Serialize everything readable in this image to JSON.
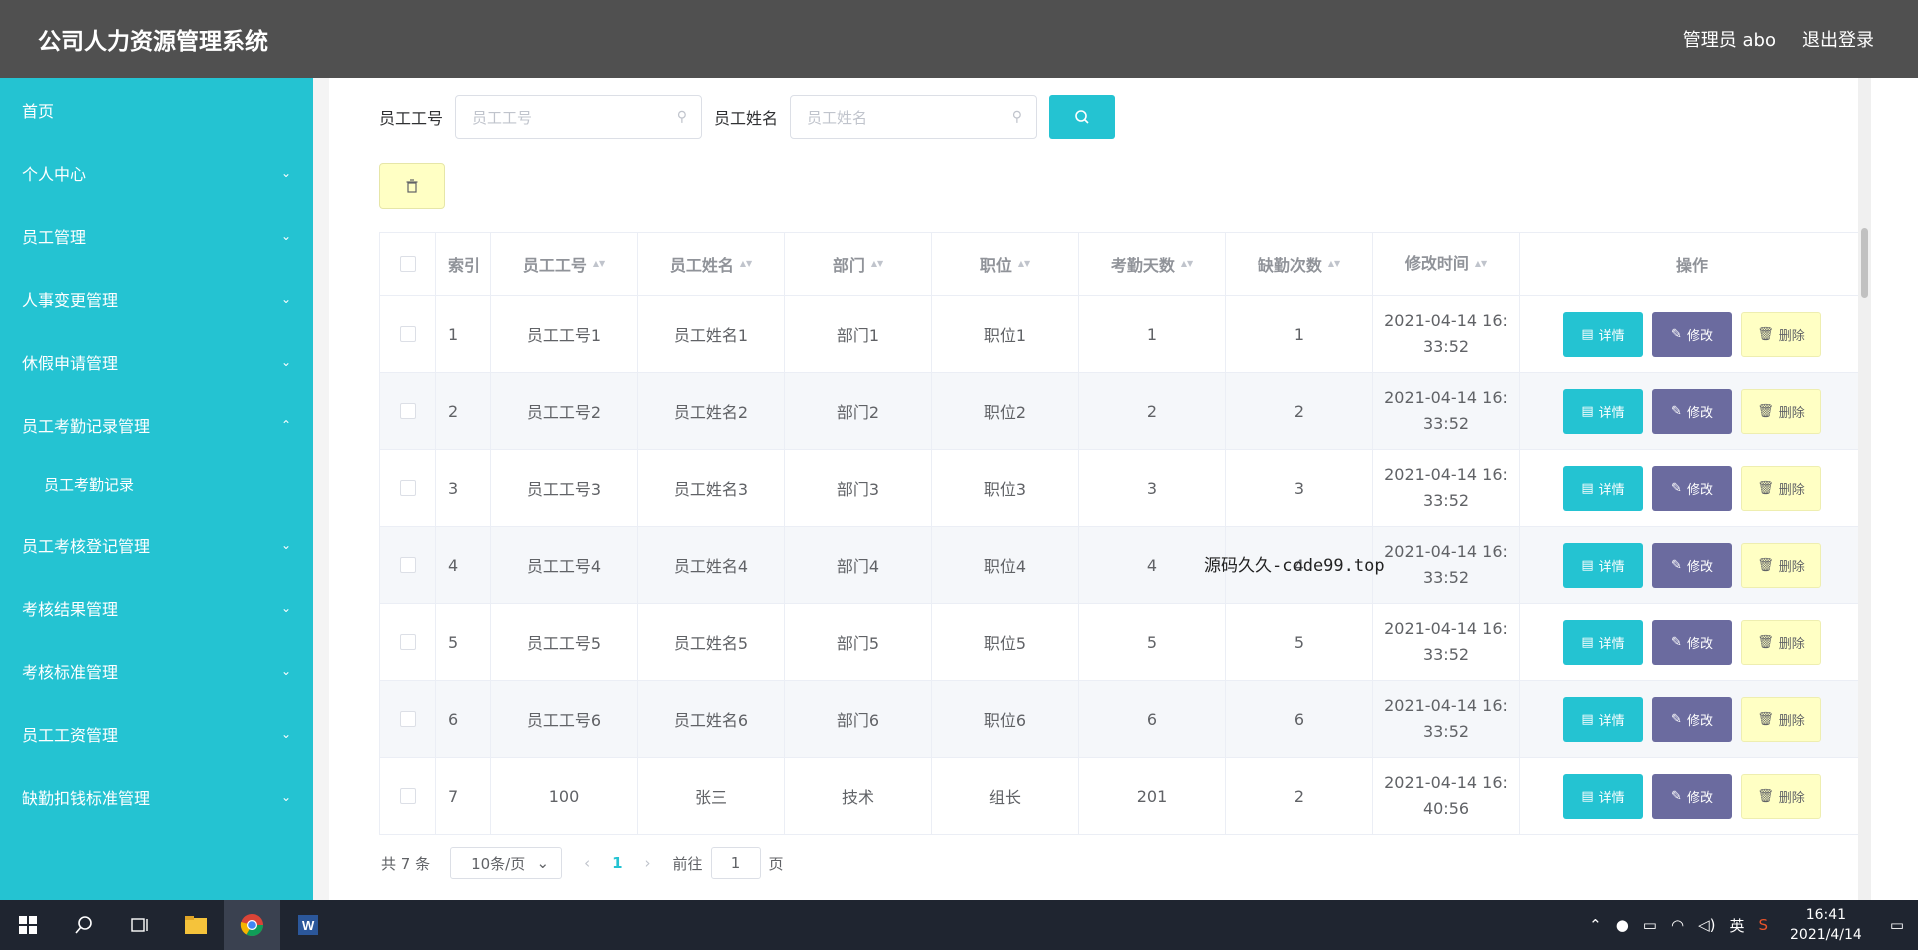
{
  "header": {
    "title": "公司人力资源管理系统",
    "admin": "管理员 abo",
    "logout": "退出登录"
  },
  "sidebar": {
    "items": [
      {
        "label": "首页",
        "chev": ""
      },
      {
        "label": "个人中心",
        "chev": "⌄"
      },
      {
        "label": "员工管理",
        "chev": "⌄"
      },
      {
        "label": "人事变更管理",
        "chev": "⌄"
      },
      {
        "label": "休假申请管理",
        "chev": "⌄"
      },
      {
        "label": "员工考勤记录管理",
        "chev": "⌃"
      },
      {
        "label": "员工考勤记录",
        "chev": ""
      },
      {
        "label": "员工考核登记管理",
        "chev": "⌄"
      },
      {
        "label": "考核结果管理",
        "chev": "⌄"
      },
      {
        "label": "考核标准管理",
        "chev": "⌄"
      },
      {
        "label": "员工工资管理",
        "chev": "⌄"
      },
      {
        "label": "缺勤扣钱标准管理",
        "chev": "⌄"
      }
    ]
  },
  "search": {
    "id_label": "员工工号",
    "id_placeholder": "员工工号",
    "name_label": "员工姓名",
    "name_placeholder": "员工姓名"
  },
  "table": {
    "headers": [
      "索引",
      "员工工号",
      "员工姓名",
      "部门",
      "职位",
      "考勤天数",
      "缺勤次数",
      "修改时间",
      "操作"
    ],
    "rows": [
      {
        "idx": "1",
        "id": "员工工号1",
        "name": "员工姓名1",
        "dept": "部门1",
        "pos": "职位1",
        "days": "1",
        "absent": "1",
        "time1": "2021-04-14 16:",
        "time2": "33:52"
      },
      {
        "idx": "2",
        "id": "员工工号2",
        "name": "员工姓名2",
        "dept": "部门2",
        "pos": "职位2",
        "days": "2",
        "absent": "2",
        "time1": "2021-04-14 16:",
        "time2": "33:52"
      },
      {
        "idx": "3",
        "id": "员工工号3",
        "name": "员工姓名3",
        "dept": "部门3",
        "pos": "职位3",
        "days": "3",
        "absent": "3",
        "time1": "2021-04-14 16:",
        "time2": "33:52"
      },
      {
        "idx": "4",
        "id": "员工工号4",
        "name": "员工姓名4",
        "dept": "部门4",
        "pos": "职位4",
        "days": "4",
        "absent": "4",
        "time1": "2021-04-14 16:",
        "time2": "33:52"
      },
      {
        "idx": "5",
        "id": "员工工号5",
        "name": "员工姓名5",
        "dept": "部门5",
        "pos": "职位5",
        "days": "5",
        "absent": "5",
        "time1": "2021-04-14 16:",
        "time2": "33:52"
      },
      {
        "idx": "6",
        "id": "员工工号6",
        "name": "员工姓名6",
        "dept": "部门6",
        "pos": "职位6",
        "days": "6",
        "absent": "6",
        "time1": "2021-04-14 16:",
        "time2": "33:52"
      },
      {
        "idx": "7",
        "id": "100",
        "name": "张三",
        "dept": "技术",
        "pos": "组长",
        "days": "201",
        "absent": "2",
        "time1": "2021-04-14 16:",
        "time2": "40:56"
      }
    ],
    "ops": {
      "detail": "详情",
      "edit": "修改",
      "delete": "删除"
    }
  },
  "pager": {
    "total": "共 7 条",
    "size": "10条/页",
    "current": "1",
    "goto": "前往",
    "goto_value": "1",
    "page": "页"
  },
  "overlay": "源码久久-code99.top",
  "taskbar": {
    "time": "16:41",
    "date": "2021/4/14",
    "ime": "英"
  },
  "colors": {
    "accent": "#24c3d2",
    "edit": "#6b6b9f",
    "delete": "#ffffc4",
    "header": "#505050"
  }
}
